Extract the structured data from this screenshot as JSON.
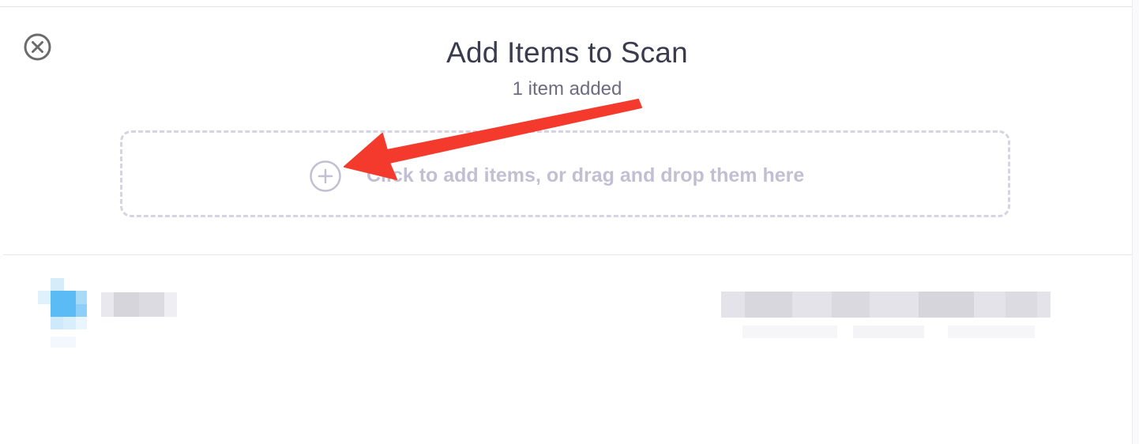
{
  "dialog": {
    "title": "Add Items to Scan",
    "subtitle": "1 item added",
    "close_icon": "close-circle-icon"
  },
  "dropzone": {
    "label": "Click to add items, or drag and drop them here",
    "icon": "plus-circle-icon"
  },
  "items": [
    {
      "icon": "folder-icon"
    }
  ],
  "colors": {
    "title": "#3b3b4f",
    "subtitle": "#6e6c80",
    "dropzone_border": "#d7d4e2",
    "dropzone_text": "#c3bfd2",
    "annotation_arrow": "#f33a2c",
    "item_icon": "#5bbcf5"
  }
}
